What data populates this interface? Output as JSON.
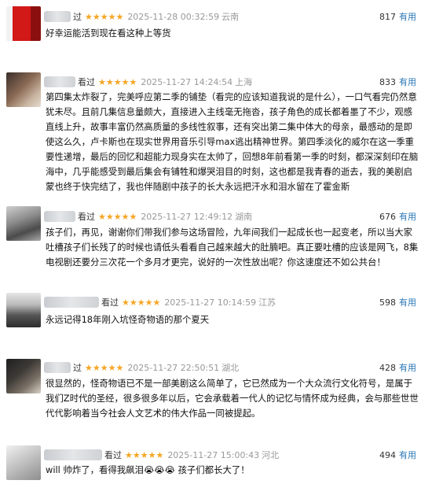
{
  "comments": [
    {
      "status": "过",
      "rating_stars": "★★★★★",
      "time": "2025-11-28 00:32:59",
      "location": "云南",
      "votes": "817",
      "useful_label": "有用",
      "text": "好幸运能活到现在看这种上等货"
    },
    {
      "status": "看过",
      "rating_stars": "★★★★★",
      "time": "2025-11-27 14:24:54",
      "location": "上海",
      "votes": "833",
      "useful_label": "有用",
      "text": "第四集太炸裂了，完美呼应第二季的铺垫（看完的应该知道我说的是什么），一口气看完仍然意犹未尽。且前几集信息量颇大，直接进入主线毫无拖沓，孩子角色的成长都着墨了不少，观感直线上升，故事丰富仍然高质量的多线性叙事，还有突出第二集中体大的母亲，最感动的是即使这么久，卢卡斯也在现实世界用音乐引导max逃出精神世界。第四季淡化的威尔在这一季重要性递增，最后的回忆和超能力现身实在太帅了，回想8年前看第一季的时刻，都深深刻印在脑海中，几乎能感受到最后集会有铺牲和爆哭泪目的时刻，这也都是我青春的逝去，我的美剧启蒙也终于快完结了，我也伴随剧中孩子的长大永远把汗水和泪水留在了霍金斯"
    },
    {
      "status": "看过",
      "rating_stars": "★★★★★",
      "time": "2025-11-27 12:49:12",
      "location": "湖南",
      "votes": "676",
      "useful_label": "有用",
      "text": "孩子们，再见，谢谢你们带我们参与这场冒险，九年间我们一起成长也一起变老，所以当大家吐槽孩子们长残了的时候也请低头看看自己越来越大的肚腩吧。真正要吐槽的应该是网飞，8集电视剧还要分三次花一个多月才更完，说好的一次性放出呢？你这速度还不如公共台！"
    },
    {
      "status": "看过",
      "rating_stars": "★★★★★",
      "time": "2025-11-27 10:14:59",
      "location": "江苏",
      "votes": "598",
      "useful_label": "有用",
      "text": "永远记得18年刚入坑怪奇物语的那个夏天"
    },
    {
      "status": "过",
      "rating_stars": "★★★★★",
      "time": "2025-11-27 22:50:51",
      "location": "湖北",
      "votes": "428",
      "useful_label": "有用",
      "text": "很显然的，怪奇物语已不是一部美剧这么简单了，它已然成为一个大众流行文化符号，是属于我们Z时代的圣经，很多很多年以后，它会承载着一代人的记忆与情怀成为经典，会与那些世世代代影响着当今社会人文艺术的伟大作品一同被提起。"
    },
    {
      "status": "看过",
      "rating_stars": "★★★★★",
      "time": "2025-11-27 15:00:43",
      "location": "河北",
      "votes": "494",
      "useful_label": "有用",
      "text_before": "will 帅炸了，看得我飙泪",
      "emoji": "😭😭😭",
      "text_after": " 孩子们都长大了！"
    }
  ]
}
